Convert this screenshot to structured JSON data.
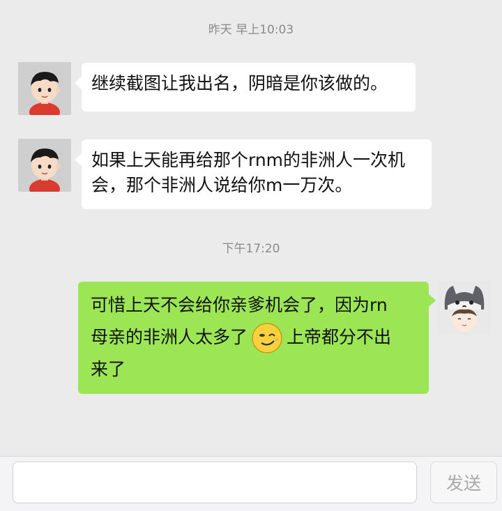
{
  "messages": [
    {
      "timestamp": "昨天 早上10:03",
      "text": "继续截图让我出名，阴暗是你该做的。"
    },
    {
      "line1": "如果上天能再给那个rnm的非洲人一次机",
      "line2": "会，那个非洲人说给你m一万次。"
    },
    {
      "timestamp": "下午17:20",
      "line1": "可惜上天不会给你亲爹机会了，因为rn",
      "line2a": "母亲的非洲人太多了",
      "emoji": "smirk-emoji",
      "line2b": "上帝都分不出",
      "line3": "来了"
    }
  ],
  "input": {
    "value": "",
    "placeholder": "",
    "send_label": "发送"
  },
  "colors": {
    "background": "#ebebeb",
    "incoming_bubble": "#ffffff",
    "outgoing_bubble": "#9ce554",
    "timestamp_text": "#8a8a8a"
  }
}
